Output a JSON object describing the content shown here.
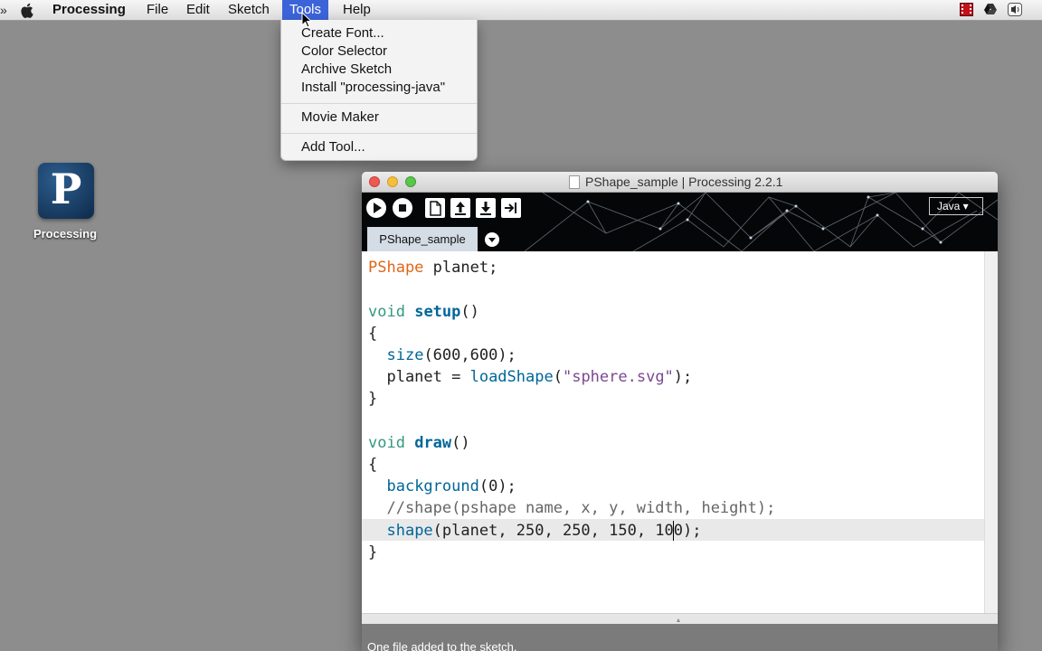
{
  "menubar": {
    "app_name": "Processing",
    "items": [
      "File",
      "Edit",
      "Sketch",
      "Tools",
      "Help"
    ],
    "active_item": "Tools",
    "status_icons": [
      "recording-icon",
      "google-drive-icon",
      "volume-icon"
    ],
    "overflow": "»"
  },
  "tools_menu": {
    "items": [
      "Create Font...",
      "Color Selector",
      "Archive Sketch",
      "Install \"processing-java\"",
      "Movie Maker",
      "Add Tool..."
    ]
  },
  "desktop": {
    "icon_letter": "P",
    "icon_label": "Processing"
  },
  "window": {
    "title": "PShape_sample | Processing 2.2.1",
    "toolbar_buttons": [
      "run-icon",
      "stop-icon",
      "new-icon",
      "open-icon",
      "save-icon",
      "export-icon"
    ],
    "mode": "Java ▾",
    "tab_name": "PShape_sample",
    "status_message": "One file added to the sketch."
  },
  "code": {
    "l1": [
      "PShape",
      " planet;"
    ],
    "l3": [
      "void",
      " ",
      "setup",
      "()"
    ],
    "l4": "{",
    "l5": [
      "  ",
      "size",
      "(600,600);"
    ],
    "l6": [
      "  planet = ",
      "loadShape",
      "(",
      "\"sphere.svg\"",
      ");"
    ],
    "l7": "}",
    "l9": [
      "void",
      " ",
      "draw",
      "()"
    ],
    "l10": "{",
    "l11": [
      "  ",
      "background",
      "(0);"
    ],
    "l12": "  //shape(pshape name, x, y, width, height);",
    "l13": [
      "  ",
      "shape",
      "(planet, 250, 250, 150, 100);"
    ],
    "l14": "}"
  },
  "colors": {
    "menu_highlight": "#3c64d9",
    "syntax_type": "#e2661a",
    "syntax_keyword": "#33997e",
    "syntax_function": "#006699",
    "syntax_string": "#7d4793"
  }
}
